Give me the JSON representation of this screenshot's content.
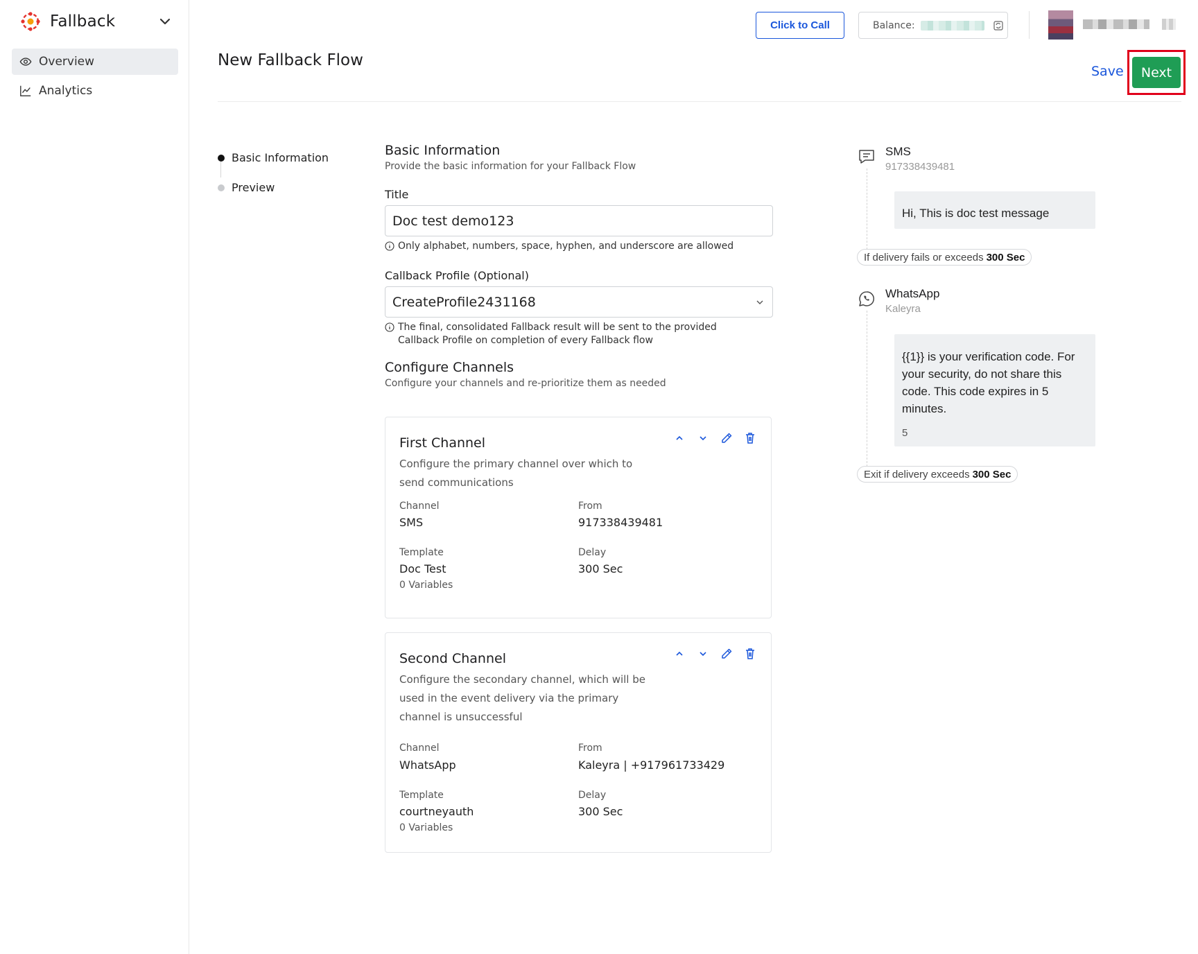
{
  "app": {
    "name": "Fallback",
    "nav": [
      {
        "label": "Overview",
        "icon": "eye-icon",
        "active": true
      },
      {
        "label": "Analytics",
        "icon": "line-chart-icon",
        "active": false
      }
    ]
  },
  "header": {
    "call_label": "Click to Call",
    "balance_label": "Balance:"
  },
  "page": {
    "title": "New Fallback Flow",
    "save_label": "Save",
    "next_label": "Next"
  },
  "stepper": {
    "steps": [
      {
        "label": "Basic Information",
        "active": true
      },
      {
        "label": "Preview",
        "active": false
      }
    ]
  },
  "form": {
    "basic_title": "Basic Information",
    "basic_sub": "Provide the basic information for your Fallback Flow",
    "title_label": "Title",
    "title_value": "Doc test demo123",
    "title_hint": "Only alphabet, numbers, space, hyphen, and underscore are allowed",
    "callback_label": "Callback Profile (Optional)",
    "callback_value": "CreateProfile2431168",
    "callback_hint_1": "The final, consolidated Fallback result will be sent to the provided",
    "callback_hint_2": "Callback Profile on completion of every Fallback flow",
    "channels_title": "Configure Channels",
    "channels_sub": "Configure your channels and re-prioritize them as needed"
  },
  "channels": [
    {
      "title": "First Channel",
      "desc": [
        "Configure the primary channel over which to",
        "send communications"
      ],
      "channel_label": "Channel",
      "channel": "SMS",
      "from_label": "From",
      "from": "917338439481",
      "template_label": "Template",
      "template": "Doc Test",
      "variables": "0 Variables",
      "delay_label": "Delay",
      "delay": "300 Sec"
    },
    {
      "title": "Second Channel",
      "desc": [
        "Configure the secondary channel, which will be",
        "used in the event delivery via the primary",
        "channel is unsuccessful"
      ],
      "channel_label": "Channel",
      "channel": "WhatsApp",
      "from_label": "From",
      "from": "Kaleyra | +917961733429",
      "template_label": "Template",
      "template": "courtneyauth",
      "variables": "0 Variables",
      "delay_label": "Delay",
      "delay": "300 Sec"
    }
  ],
  "preview": {
    "sms": {
      "name": "SMS",
      "sub": "917338439481",
      "message": "Hi, This is doc test message"
    },
    "fail_pill": {
      "text": "If delivery fails or exceeds",
      "value": "300 Sec"
    },
    "whatsapp": {
      "name": "WhatsApp",
      "sub": "Kaleyra",
      "message": [
        "{{1}} is your verification code. For",
        "your security, do not share this",
        "code. This code expires in 5",
        "minutes."
      ],
      "footer": "5"
    },
    "exit_pill": {
      "text": "Exit if delivery exceeds",
      "value": "300 Sec"
    }
  },
  "colors": {
    "accent": "#1a56db",
    "success": "#1f9d55",
    "highlight": "#e0001b",
    "brand": "#e5322d"
  }
}
